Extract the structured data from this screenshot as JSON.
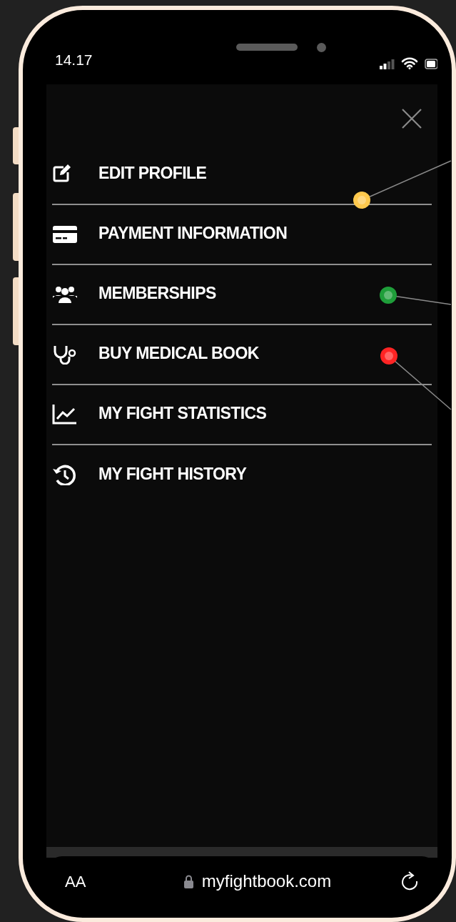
{
  "status_bar": {
    "time": "14.17"
  },
  "menu": {
    "items": [
      {
        "label": "EDIT PROFILE",
        "kind": "edit",
        "marker": {
          "color": "#ffc94d"
        }
      },
      {
        "label": "PAYMENT INFORMATION",
        "kind": "card"
      },
      {
        "label": "MEMBERSHIPS",
        "kind": "users",
        "marker": {
          "color": "#1f9e3a"
        }
      },
      {
        "label": "BUY MEDICAL BOOK",
        "kind": "stethoscope",
        "marker": {
          "color": "#ff2424"
        }
      },
      {
        "label": "MY FIGHT STATISTICS",
        "kind": "chart"
      },
      {
        "label": "MY FIGHT HISTORY",
        "kind": "history"
      }
    ]
  },
  "browser_bar": {
    "text_size": "AA",
    "url": "myfightbook.com"
  }
}
